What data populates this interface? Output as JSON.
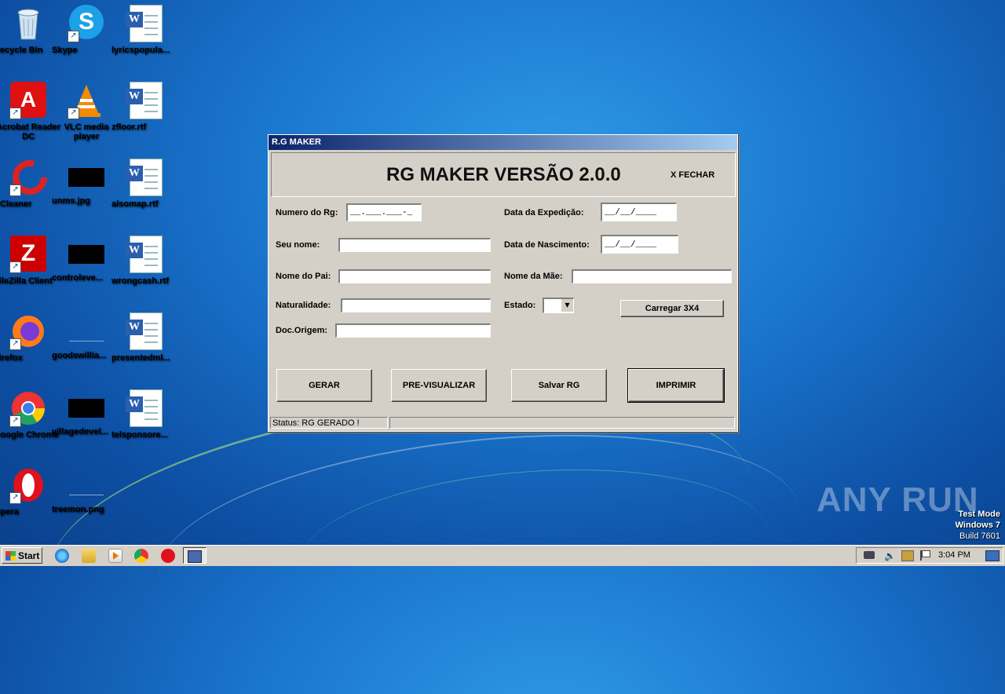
{
  "desktop": {
    "icons": [
      {
        "label": "Recycle Bin"
      },
      {
        "label": "Skype"
      },
      {
        "label": "lyricspopula..."
      },
      {
        "label": "Acrobat Reader DC"
      },
      {
        "label": "VLC media player"
      },
      {
        "label": "zfloor.rtf"
      },
      {
        "label": "CCleaner"
      },
      {
        "label": "unms.jpg"
      },
      {
        "label": "alsomap.rtf"
      },
      {
        "label": "FileZilla Client"
      },
      {
        "label": "controleve..."
      },
      {
        "label": "wrongcash.rtf"
      },
      {
        "label": "Firefox"
      },
      {
        "label": "goodswillia..."
      },
      {
        "label": "presentedml..."
      },
      {
        "label": "Google Chrome"
      },
      {
        "label": "villagedevel..."
      },
      {
        "label": "telsponsore..."
      },
      {
        "label": "Opera"
      },
      {
        "label": "treemon.png"
      }
    ]
  },
  "window": {
    "title": "R.G MAKER",
    "banner_title": "RG MAKER VERSÃO 2.0.0",
    "close_label": "X FECHAR",
    "fields": {
      "numero_rg": {
        "label": "Numero do Rg:",
        "value": "__.___.___-_"
      },
      "seu_nome": {
        "label": "Seu nome:",
        "value": ""
      },
      "nome_pai": {
        "label": "Nome do Pai:",
        "value": ""
      },
      "naturalidade": {
        "label": "Naturalidade:",
        "value": ""
      },
      "doc_origem": {
        "label": "Doc.Origem:",
        "value": ""
      },
      "data_expedicao": {
        "label": "Data da Expedição:",
        "value": "__/__/____"
      },
      "data_nascimento": {
        "label": "Data de Nascimento:",
        "value": "__/__/____"
      },
      "nome_mae": {
        "label": "Nome da Mãe:",
        "value": ""
      },
      "estado": {
        "label": "Estado:",
        "value": ""
      }
    },
    "buttons": {
      "carregar": "Carregar  3X4",
      "gerar": "GERAR",
      "previsualizar": "PRE-VISUALIZAR",
      "salvar": "Salvar RG",
      "imprimir": "IMPRIMIR"
    },
    "status": "Status: RG GERADO !"
  },
  "watermark": {
    "brand": "ANY RUN",
    "test_mode": "Test Mode",
    "os": "Windows 7",
    "build": "Build 7601"
  },
  "taskbar": {
    "start_label": "Start",
    "clock": "3:04 PM"
  },
  "icon_names": [
    "recycle-bin-icon",
    "skype-icon",
    "word-doc-icon",
    "acrobat-icon",
    "vlc-icon",
    "ccleaner-icon",
    "filezilla-icon",
    "firefox-icon",
    "chrome-icon",
    "opera-icon"
  ]
}
